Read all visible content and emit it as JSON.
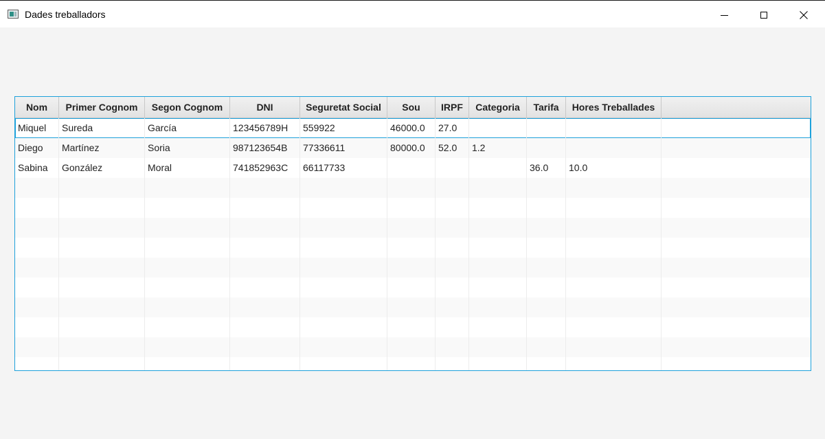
{
  "window": {
    "title": "Dades treballadors"
  },
  "table": {
    "columns": [
      "Nom",
      "Primer Cognom",
      "Segon Cognom",
      "DNI",
      "Seguretat Social",
      "Sou",
      "IRPF",
      "Categoria",
      "Tarifa",
      "Hores Treballades",
      ""
    ],
    "rows": [
      [
        "Miquel",
        "Sureda",
        "García",
        "123456789H",
        "559922",
        "46000.0",
        "27.0",
        "",
        "",
        "",
        ""
      ],
      [
        "Diego",
        "Martínez",
        "Soria",
        "987123654B",
        "77336611",
        "80000.0",
        "52.0",
        "1.2",
        "",
        "",
        ""
      ],
      [
        "Sabina",
        "González",
        "Moral",
        "741852963C",
        "66117733",
        "",
        "",
        "",
        "36.0",
        "10.0",
        ""
      ]
    ],
    "empty_row_count": 10
  },
  "colors": {
    "accent": "#1da1db",
    "header_bg": "#e8e8e8",
    "window_bg": "#f4f4f4"
  }
}
